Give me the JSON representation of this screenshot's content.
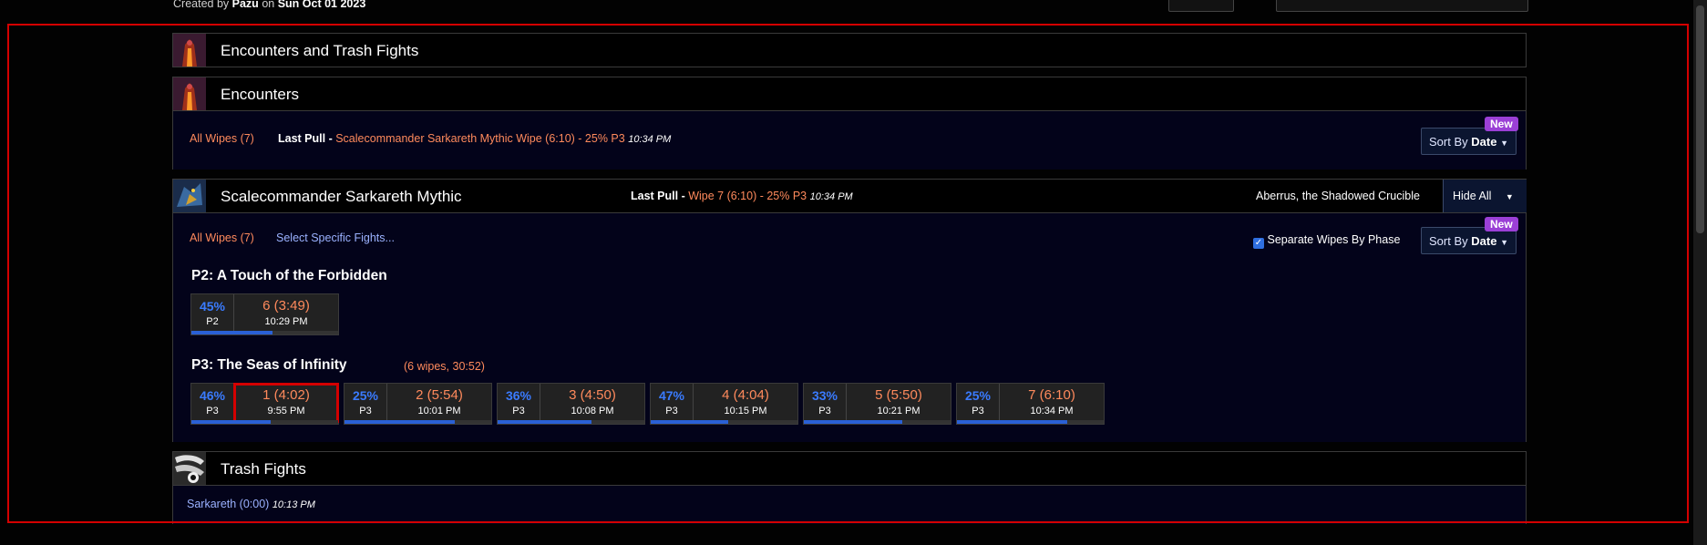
{
  "top": {
    "created_by_prefix": "Created by",
    "author": "Pazu",
    "on": "on",
    "date": "Sun Oct 01 2023"
  },
  "encounters_trash": {
    "title": "Encounters and Trash Fights",
    "icon": "boss-portrait-icon"
  },
  "encounters": {
    "title": "Encounters",
    "all_wipes": "All Wipes (7)",
    "last_pull_label": "Last Pull -",
    "last_pull_text": "Scalecommander Sarkareth Mythic Wipe (6:10) - 25% P3",
    "last_pull_time": "10:34 PM",
    "sort_label": "Sort By",
    "sort_value": "Date",
    "new_badge": "New"
  },
  "boss": {
    "title": "Scalecommander Sarkareth Mythic",
    "last_pull_label": "Last Pull -",
    "last_pull_text": "Wipe 7 (6:10) - 25% P3",
    "last_pull_time": "10:34 PM",
    "zone": "Aberrus, the Shadowed Crucible",
    "hide_all": "Hide All",
    "all_wipes": "All Wipes (7)",
    "select_specific": "Select Specific Fights...",
    "separate_wipes": "Separate Wipes By Phase",
    "sort_label": "Sort By",
    "sort_value": "Date",
    "new_badge": "New",
    "phases": [
      {
        "title": "P2: A Touch of the Forbidden",
        "summary": "",
        "fights": [
          {
            "pct": "45%",
            "phase": "P2",
            "label": "6 (3:49)",
            "time": "10:29 PM",
            "progress": 0.55
          }
        ]
      },
      {
        "title": "P3: The Seas of Infinity",
        "summary": "(6 wipes, 30:52)",
        "fights": [
          {
            "pct": "46%",
            "phase": "P3",
            "label": "1 (4:02)",
            "time": "9:55 PM",
            "progress": 0.54,
            "selected": true
          },
          {
            "pct": "25%",
            "phase": "P3",
            "label": "2 (5:54)",
            "time": "10:01 PM",
            "progress": 0.75
          },
          {
            "pct": "36%",
            "phase": "P3",
            "label": "3 (4:50)",
            "time": "10:08 PM",
            "progress": 0.64
          },
          {
            "pct": "47%",
            "phase": "P3",
            "label": "4 (4:04)",
            "time": "10:15 PM",
            "progress": 0.53
          },
          {
            "pct": "33%",
            "phase": "P3",
            "label": "5 (5:50)",
            "time": "10:21 PM",
            "progress": 0.67
          },
          {
            "pct": "25%",
            "phase": "P3",
            "label": "7 (6:10)",
            "time": "10:34 PM",
            "progress": 0.75
          }
        ]
      }
    ]
  },
  "trash": {
    "title": "Trash Fights",
    "entry": "Sarkareth (0:00)",
    "entry_time": "10:13 PM"
  },
  "colors": {
    "accent_orange": "#ff8a5c",
    "link_blue": "#9bb2ff",
    "pct_blue": "#3a7bff",
    "badge_purple": "#9b3fd6",
    "highlight_red": "#d40000"
  }
}
